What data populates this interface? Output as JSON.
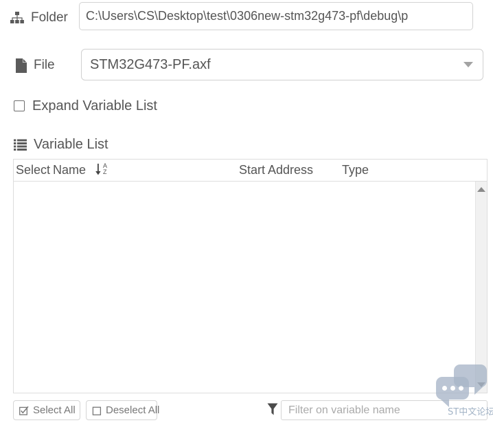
{
  "folder": {
    "label": "Folder",
    "icon": "sitemap-icon",
    "value": "C:\\Users\\CS\\Desktop\\test\\0306new-stm32g473-pf\\debug\\p",
    "placeholder": ""
  },
  "file": {
    "label": "File",
    "icon": "file-icon",
    "selected": "STM32G473-PF.axf",
    "caret_icon": "chevron-down-icon"
  },
  "expand": {
    "label": "Expand Variable List",
    "checked": false
  },
  "variable_list": {
    "heading": "Variable List",
    "heading_icon": "list-icon",
    "columns": [
      {
        "key": "select",
        "label": "Select"
      },
      {
        "key": "name",
        "label": "Name",
        "sort": "az",
        "sort_icon": "sort-alpha-down-icon"
      },
      {
        "key": "start_address",
        "label": "Start Address"
      },
      {
        "key": "type",
        "label": "Type"
      }
    ],
    "rows": [],
    "scrollbar": {
      "up_icon": "caret-up-icon",
      "down_icon": "caret-down-icon"
    }
  },
  "sort_glyph": {
    "arrow": "↓",
    "top": "A",
    "bottom": "Z"
  },
  "toolbar": {
    "select_all_label": "Select All",
    "select_all_icon": "checkbox-checked-icon",
    "deselect_all_label": "Deselect All",
    "deselect_all_icon": "checkbox-empty-icon",
    "filter_icon": "funnel-icon",
    "filter_placeholder": "Filter on variable name",
    "filter_value": ""
  },
  "watermark": {
    "text": "ST中文论坛",
    "chat_icon": "chat-bubbles-icon"
  },
  "colors": {
    "text": "#555555",
    "border": "#d5d5d5",
    "scrollbar_track": "#f1f1f1",
    "watermark": "#9fb0c4",
    "chat_bubble": "#a8b6c8"
  }
}
